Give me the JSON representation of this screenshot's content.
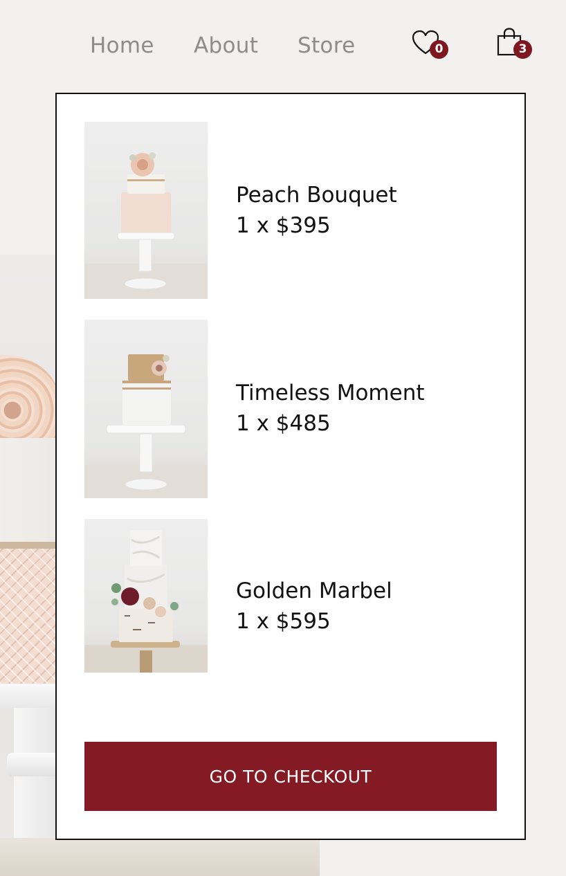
{
  "nav": {
    "links": [
      {
        "label": "Home"
      },
      {
        "label": "About"
      },
      {
        "label": "Store"
      }
    ],
    "wishlist": {
      "icon": "heart-icon",
      "count": "0"
    },
    "cart": {
      "icon": "shopping-bag-icon",
      "count": "3"
    }
  },
  "cart_panel": {
    "items": [
      {
        "name": "Peach Bouquet",
        "price": "1 x $395",
        "image": "peach-bouquet-cake-image"
      },
      {
        "name": "Timeless Moment",
        "price": "1 x $485",
        "image": "timeless-moment-cake-image"
      },
      {
        "name": "Golden Marbel",
        "price": "1 x $595",
        "image": "golden-marbel-cake-image"
      }
    ],
    "checkout_label": "GO TO CHECKOUT"
  },
  "colors": {
    "accent": "#841a24",
    "badge": "#7d1720",
    "page_bg": "#f2f1ef",
    "nav_text": "#8c8c8c"
  }
}
